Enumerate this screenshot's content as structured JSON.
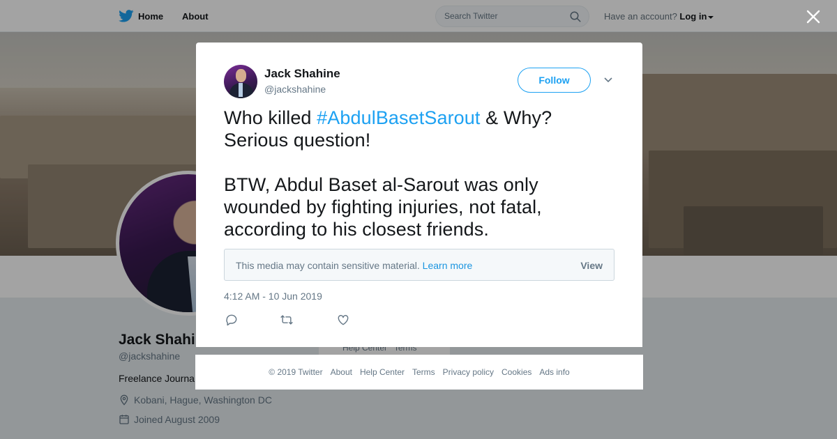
{
  "topbar": {
    "home_label": "Home",
    "about_label": "About",
    "search_placeholder": "Search Twitter",
    "account_prompt": "Have an account?",
    "login_label": "Log in"
  },
  "profile": {
    "name": "Jack Shahine",
    "handle": "@jackshahine",
    "bio": "Freelance Journa",
    "location": "Kobani, Hague, Washington DC",
    "joined": "Joined August 2009",
    "card_links": "Help Center   Terms"
  },
  "tweet": {
    "author_name": "Jack Shahine",
    "author_handle": "@jackshahine",
    "follow_label": "Follow",
    "text_before": "Who killed ",
    "hashtag": "#AbdulBasetSarout",
    "text_after": " & Why? Serious question!",
    "text_para2": "BTW, Abdul Baset al-Sarout was only wounded by fighting injuries, not fatal, according to his closest friends.",
    "sensitive_message": "This media may contain sensitive material.",
    "learn_more": "Learn more",
    "view_label": "View",
    "timestamp": "4:12 AM - 10 Jun 2019"
  },
  "footer": {
    "links": [
      "© 2019 Twitter",
      "About",
      "Help Center",
      "Terms",
      "Privacy policy",
      "Cookies",
      "Ads info"
    ]
  },
  "colors": {
    "accent": "#1da1f2",
    "link": "#1b95e0",
    "secondary_text": "#657786"
  },
  "icons": [
    "twitter-bird-icon",
    "search-icon",
    "close-icon",
    "chevron-down-icon",
    "reply-icon",
    "retweet-icon",
    "like-icon",
    "location-icon",
    "calendar-icon"
  ]
}
